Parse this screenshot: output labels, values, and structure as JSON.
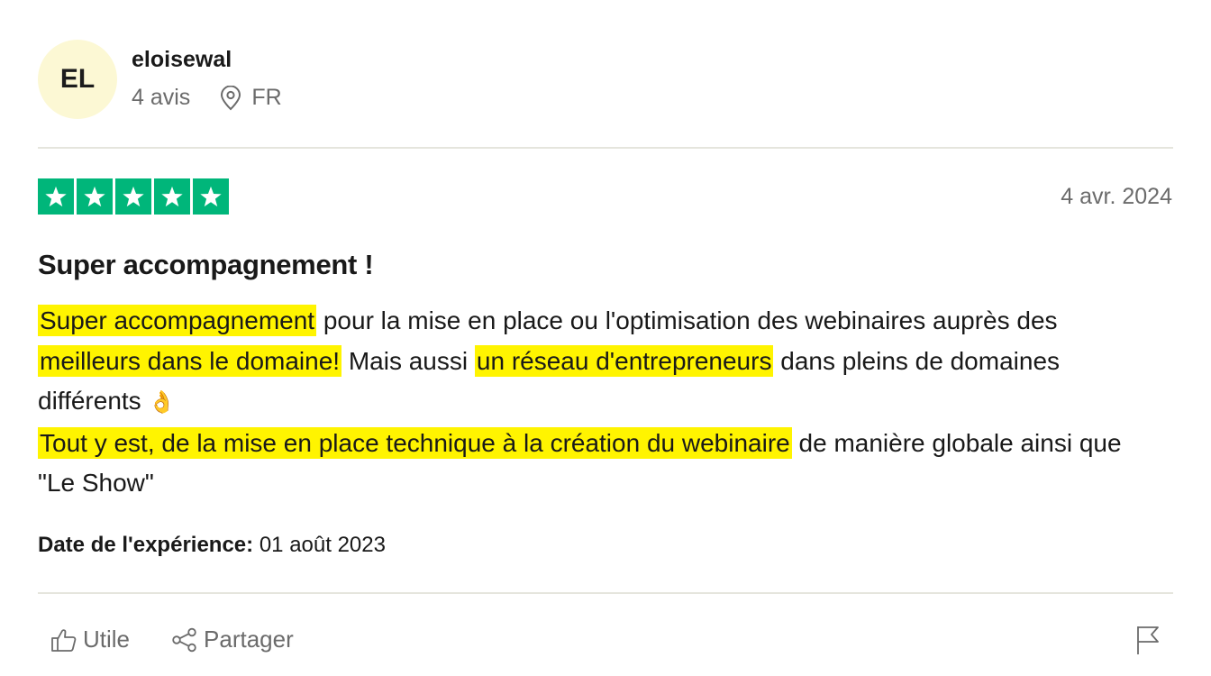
{
  "user": {
    "initials": "EL",
    "name": "eloisewal",
    "review_count": "4 avis",
    "country": "FR"
  },
  "review": {
    "rating": 5,
    "rating_color": "#00b67a",
    "date": "4 avr. 2024",
    "title": "Super accompagnement !",
    "body": {
      "h1": "Super accompagnement",
      "t1": " pour la mise en place ou l'optimisation des webinaires auprès des ",
      "h2": "meilleurs dans le domaine!",
      "t2": " Mais aussi ",
      "h3": "un réseau d'entrepreneurs",
      "t3": " dans pleins de domaines différents ",
      "emoji": "👌",
      "h4": "Tout y est, de la mise en place technique à la création du webinaire",
      "t4": " de manière globale ainsi que \"Le Show\""
    },
    "highlight_color": "#fff400",
    "experience_label": "Date de l'expérience:",
    "experience_date": " 01 août 2023"
  },
  "actions": {
    "useful_label": "Utile",
    "share_label": "Partager",
    "useful_icon": "thumbs-up-icon",
    "share_icon": "share-icon",
    "report_icon": "flag-icon"
  }
}
